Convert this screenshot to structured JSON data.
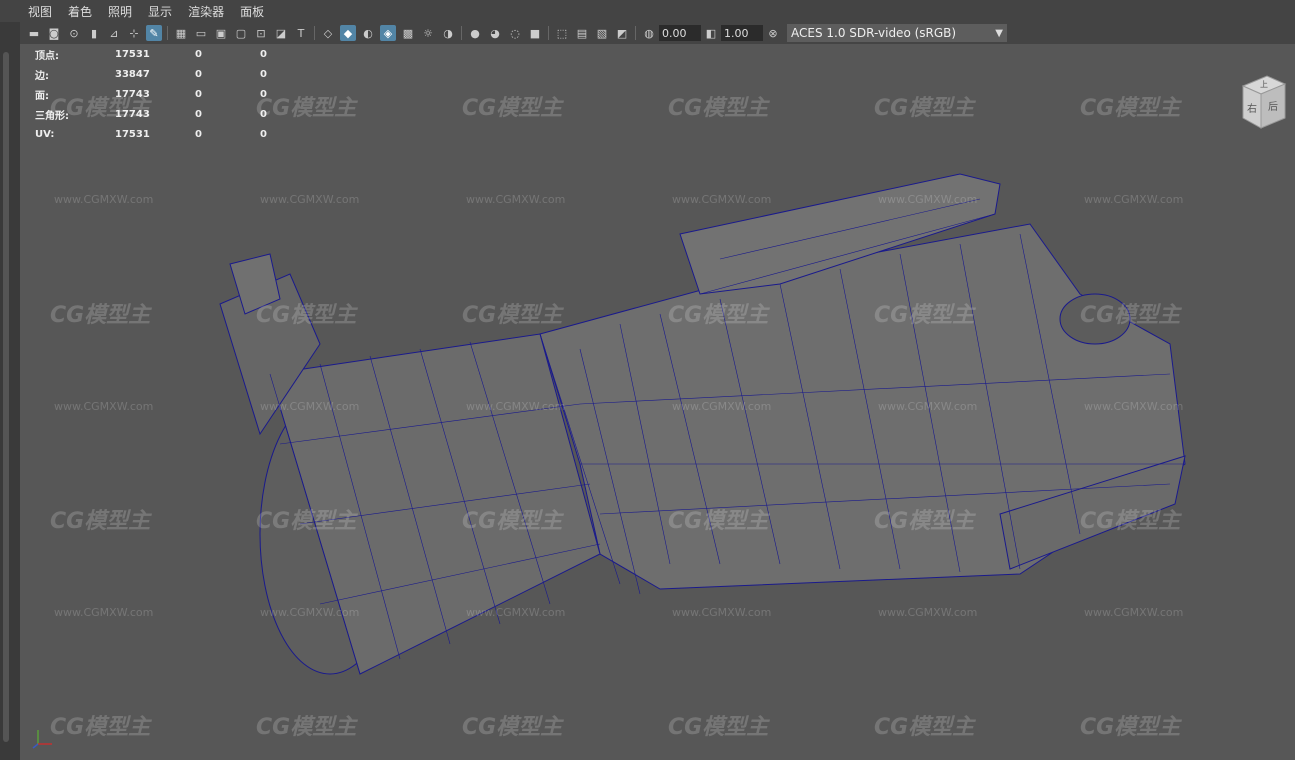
{
  "menu": [
    "视图",
    "着色",
    "照明",
    "显示",
    "渲染器",
    "面板"
  ],
  "toolbar": {
    "exposure": "0.00",
    "gamma": "1.00",
    "color_space": "ACES 1.0 SDR-video (sRGB)"
  },
  "hud": {
    "rows": [
      {
        "label": "顶点:",
        "value": "17531",
        "z1": "0",
        "z2": "0"
      },
      {
        "label": "边:",
        "value": "33847",
        "z1": "0",
        "z2": "0"
      },
      {
        "label": "面:",
        "value": "17743",
        "z1": "0",
        "z2": "0"
      },
      {
        "label": "三角形:",
        "value": "17743",
        "z1": "0",
        "z2": "0"
      },
      {
        "label": "UV:",
        "value": "17531",
        "z1": "0",
        "z2": "0"
      }
    ]
  },
  "viewcube": {
    "top": "上",
    "left": "右",
    "right": "后"
  },
  "watermark": {
    "logo": "CG模型主",
    "url": "www.CGMXW.com"
  },
  "colors": {
    "accent": "#5285a6",
    "wire": "#1a1a8c",
    "viewport": "#575757"
  }
}
